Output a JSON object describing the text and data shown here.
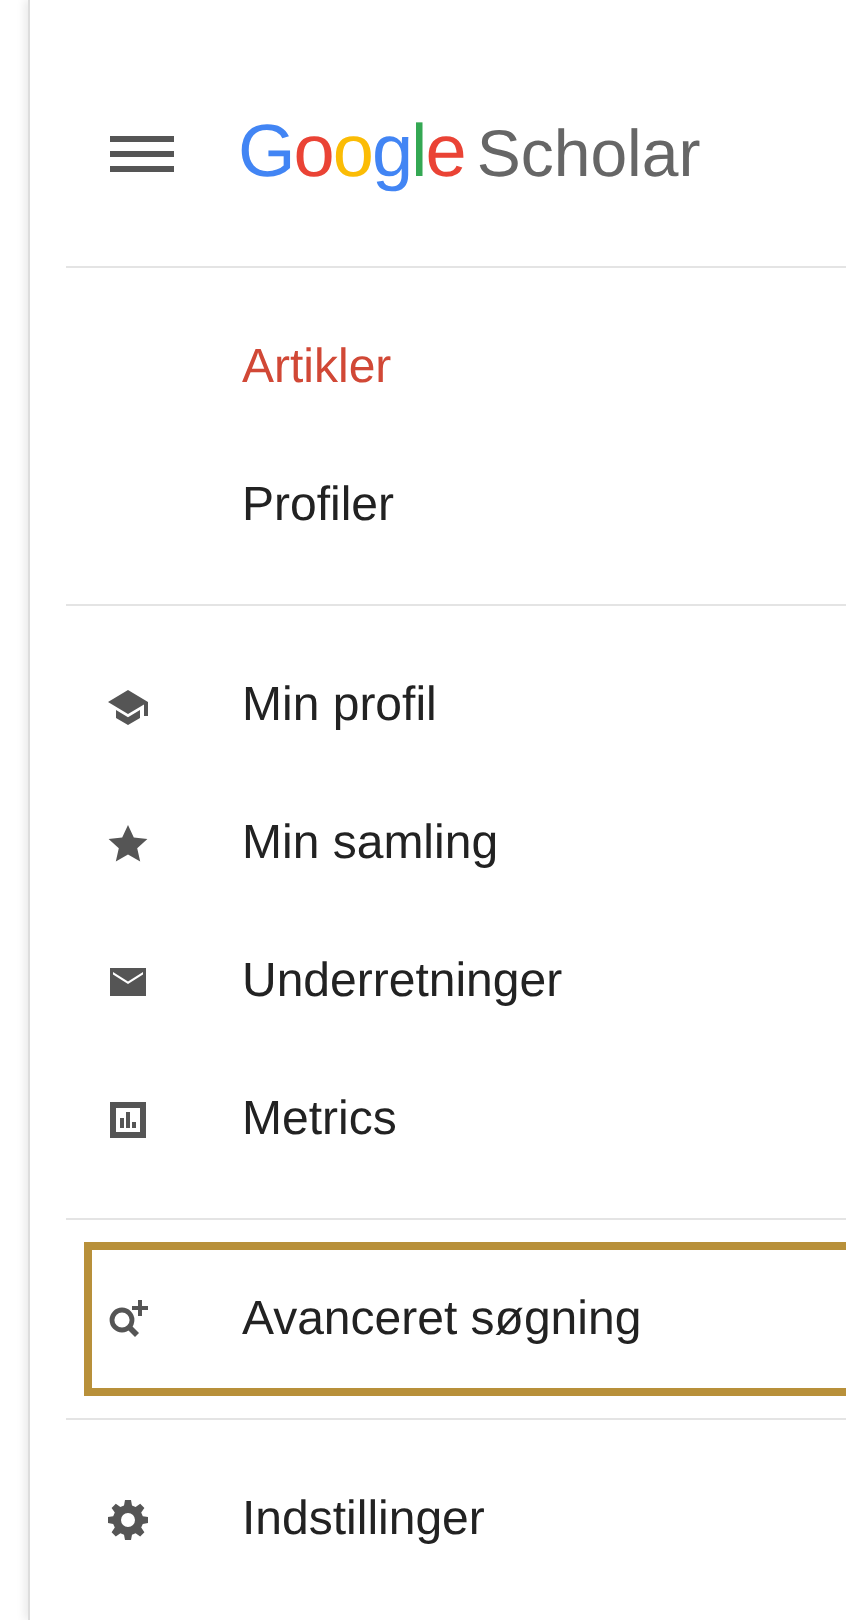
{
  "header": {
    "logo": "Google",
    "product": "Scholar"
  },
  "search_types": [
    {
      "label": "Artikler",
      "selected": true
    },
    {
      "label": "Profiler",
      "selected": false
    }
  ],
  "personal": [
    {
      "label": "Min profil"
    },
    {
      "label": "Min samling"
    },
    {
      "label": "Underretninger"
    },
    {
      "label": "Metrics"
    }
  ],
  "tools": [
    {
      "label": "Avanceret søgning",
      "highlighted": true
    }
  ],
  "settings": [
    {
      "label": "Indstillinger"
    }
  ]
}
